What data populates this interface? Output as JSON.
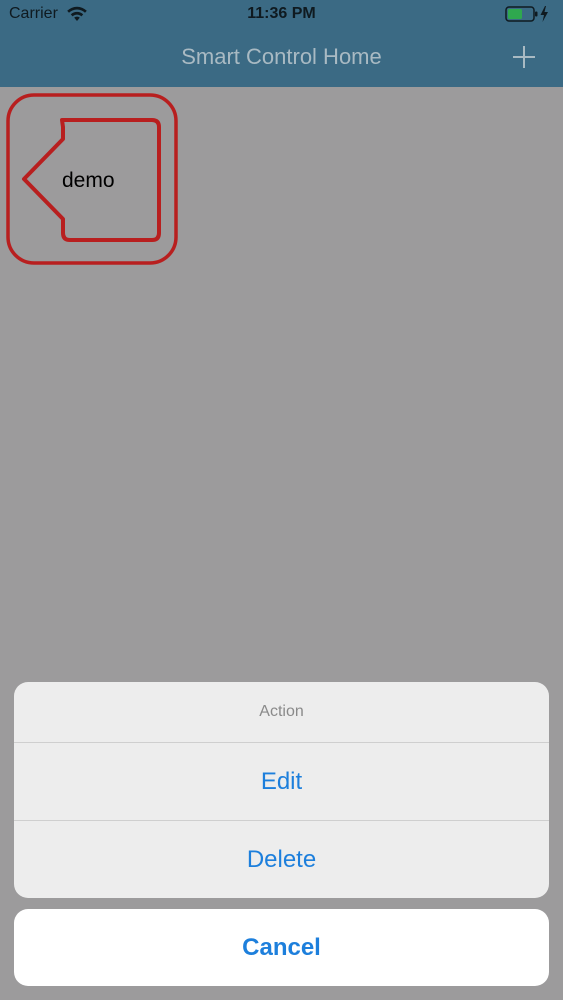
{
  "status_bar": {
    "carrier": "Carrier",
    "time": "11:36 PM",
    "wifi_icon": "wifi-icon",
    "battery_icon": "battery-charging-icon"
  },
  "nav": {
    "title": "Smart Control Home",
    "add_icon": "plus-icon"
  },
  "homes": [
    {
      "label": "demo",
      "icon": "house-icon",
      "selected": true,
      "selection_color": "#b81f1f"
    }
  ],
  "action_sheet": {
    "title": "Action",
    "items": [
      {
        "label": "Edit"
      },
      {
        "label": "Delete"
      }
    ],
    "cancel_label": "Cancel"
  },
  "colors": {
    "nav_background": "#3b6a84",
    "action_text": "#1d7fdc",
    "dimmed_background": "#9c9b9c",
    "selection_outline": "#b81f1f"
  }
}
